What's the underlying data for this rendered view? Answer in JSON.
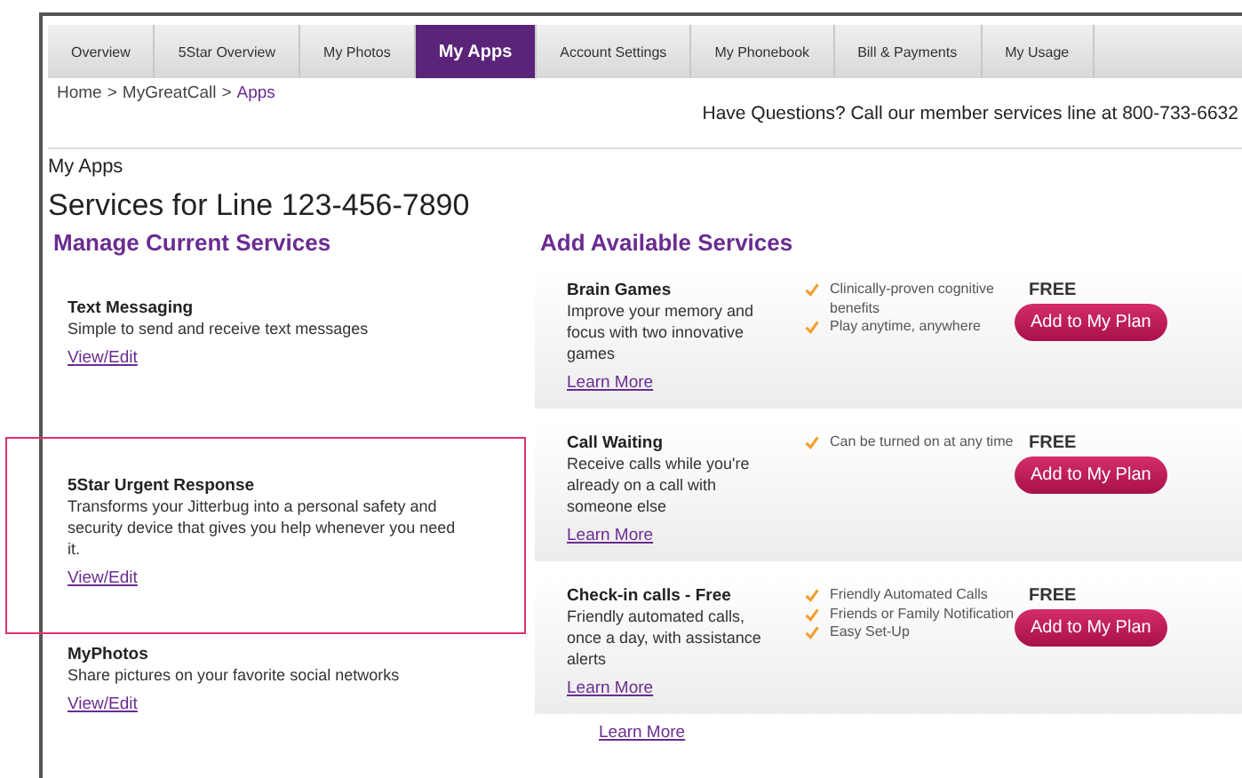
{
  "tabs": [
    {
      "label": "Overview",
      "selected": false
    },
    {
      "label": "5Star Overview",
      "selected": false
    },
    {
      "label": "My Photos",
      "selected": false
    },
    {
      "label": "My Apps",
      "selected": true
    },
    {
      "label": "Account Settings",
      "selected": false
    },
    {
      "label": "My Phonebook",
      "selected": false
    },
    {
      "label": "Bill & Payments",
      "selected": false
    },
    {
      "label": "My Usage",
      "selected": false
    }
  ],
  "breadcrumb": [
    {
      "label": "Home",
      "current": false
    },
    {
      "label": "MyGreatCall",
      "current": false
    },
    {
      "label": "Apps",
      "current": true
    }
  ],
  "breadcrumb_separator": ">",
  "help_line": "Have Questions? Call our member services line at 800-733-6632",
  "page_title": "My Apps",
  "line_title": "Services for Line 123-456-7890",
  "current_services": {
    "heading": "Manage Current Services",
    "items": [
      {
        "name": "Text Messaging",
        "description": "Simple to send and receive text messages",
        "link": "View/Edit",
        "highlighted": false
      },
      {
        "name": "5Star Urgent Response",
        "description": "Transforms your Jitterbug into a personal safety and security device that gives you help whenever you need it.",
        "link": "View/Edit",
        "highlighted": true
      },
      {
        "name": "MyPhotos",
        "description": "Share pictures on your favorite social networks",
        "link": "View/Edit",
        "highlighted": false
      }
    ]
  },
  "available_services": {
    "heading": "Add Available Services",
    "items": [
      {
        "name": "Brain Games",
        "description": "Improve your memory and focus with two innovative games",
        "link": "Learn More",
        "features": [
          "Clinically-proven cognitive benefits",
          "Play anytime, anywhere"
        ],
        "price": "FREE",
        "button": "Add to My Plan"
      },
      {
        "name": "Call Waiting",
        "description": "Receive calls while you're already on a call with someone else",
        "link": "Learn More",
        "features": [
          "Can be turned on at any time"
        ],
        "price": "FREE",
        "button": "Add to My Plan"
      },
      {
        "name": "Check-in calls - Free",
        "description": "Friendly automated calls, once a day, with assistance alerts",
        "link": "Learn More",
        "features": [
          "Friendly Automated Calls",
          "Friends or Family Notification",
          "Easy Set-Up"
        ],
        "price": "FREE",
        "button": "Add to My Plan"
      }
    ],
    "stray_link": "Learn More"
  }
}
